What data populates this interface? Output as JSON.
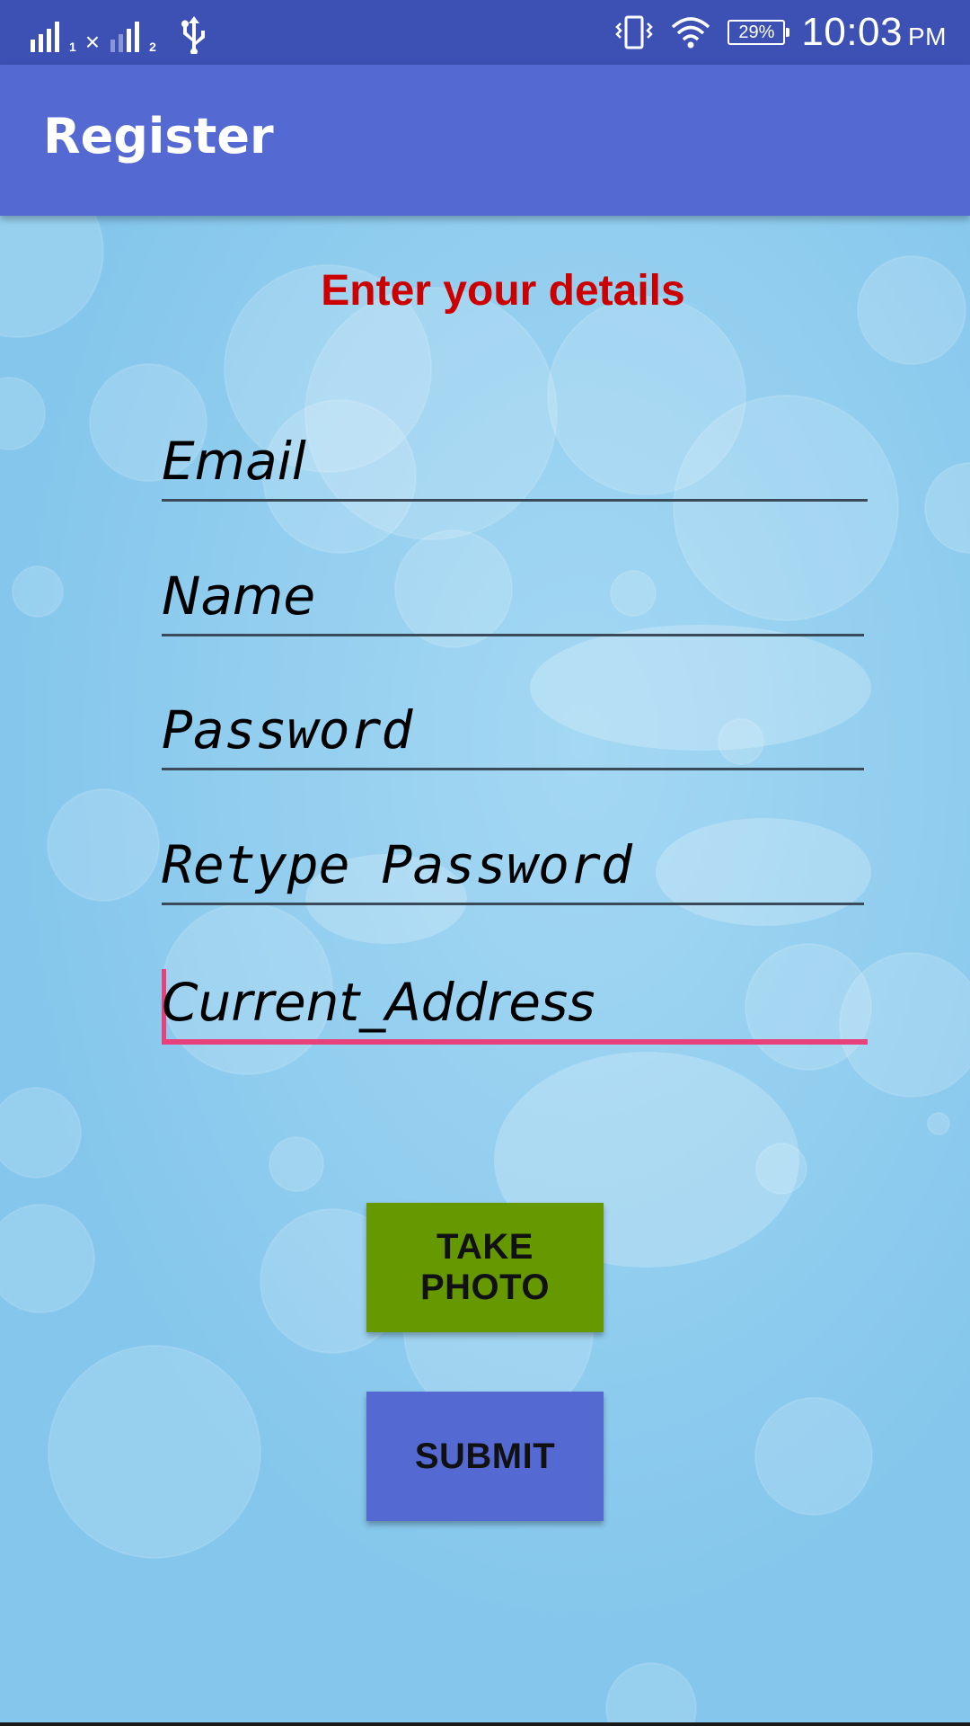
{
  "status_bar": {
    "sim1_label": "1",
    "sim2_label": "2",
    "battery_level": "29%",
    "time": "10:03",
    "ampm": "PM",
    "icons": [
      "signal-sim1-icon",
      "no-signal-x-icon",
      "signal-sim2-icon",
      "usb-icon",
      "vibrate-icon",
      "wifi-icon",
      "battery-icon"
    ]
  },
  "app_bar": {
    "title": "Register",
    "color": "#5569d2"
  },
  "form": {
    "heading": "Enter your details",
    "heading_color": "#cc0000",
    "email_placeholder": "Email",
    "name_placeholder": "Name",
    "password_placeholder": "Password",
    "retype_password_placeholder": "Retype Password",
    "address_placeholder": "Current_Address",
    "focused_field": "address",
    "accent_color": "#e8407a"
  },
  "buttons": {
    "take_photo_label": "TAKE PHOTO",
    "take_photo_color": "#669900",
    "submit_label": "SUBMIT",
    "submit_color": "#5569d2"
  }
}
